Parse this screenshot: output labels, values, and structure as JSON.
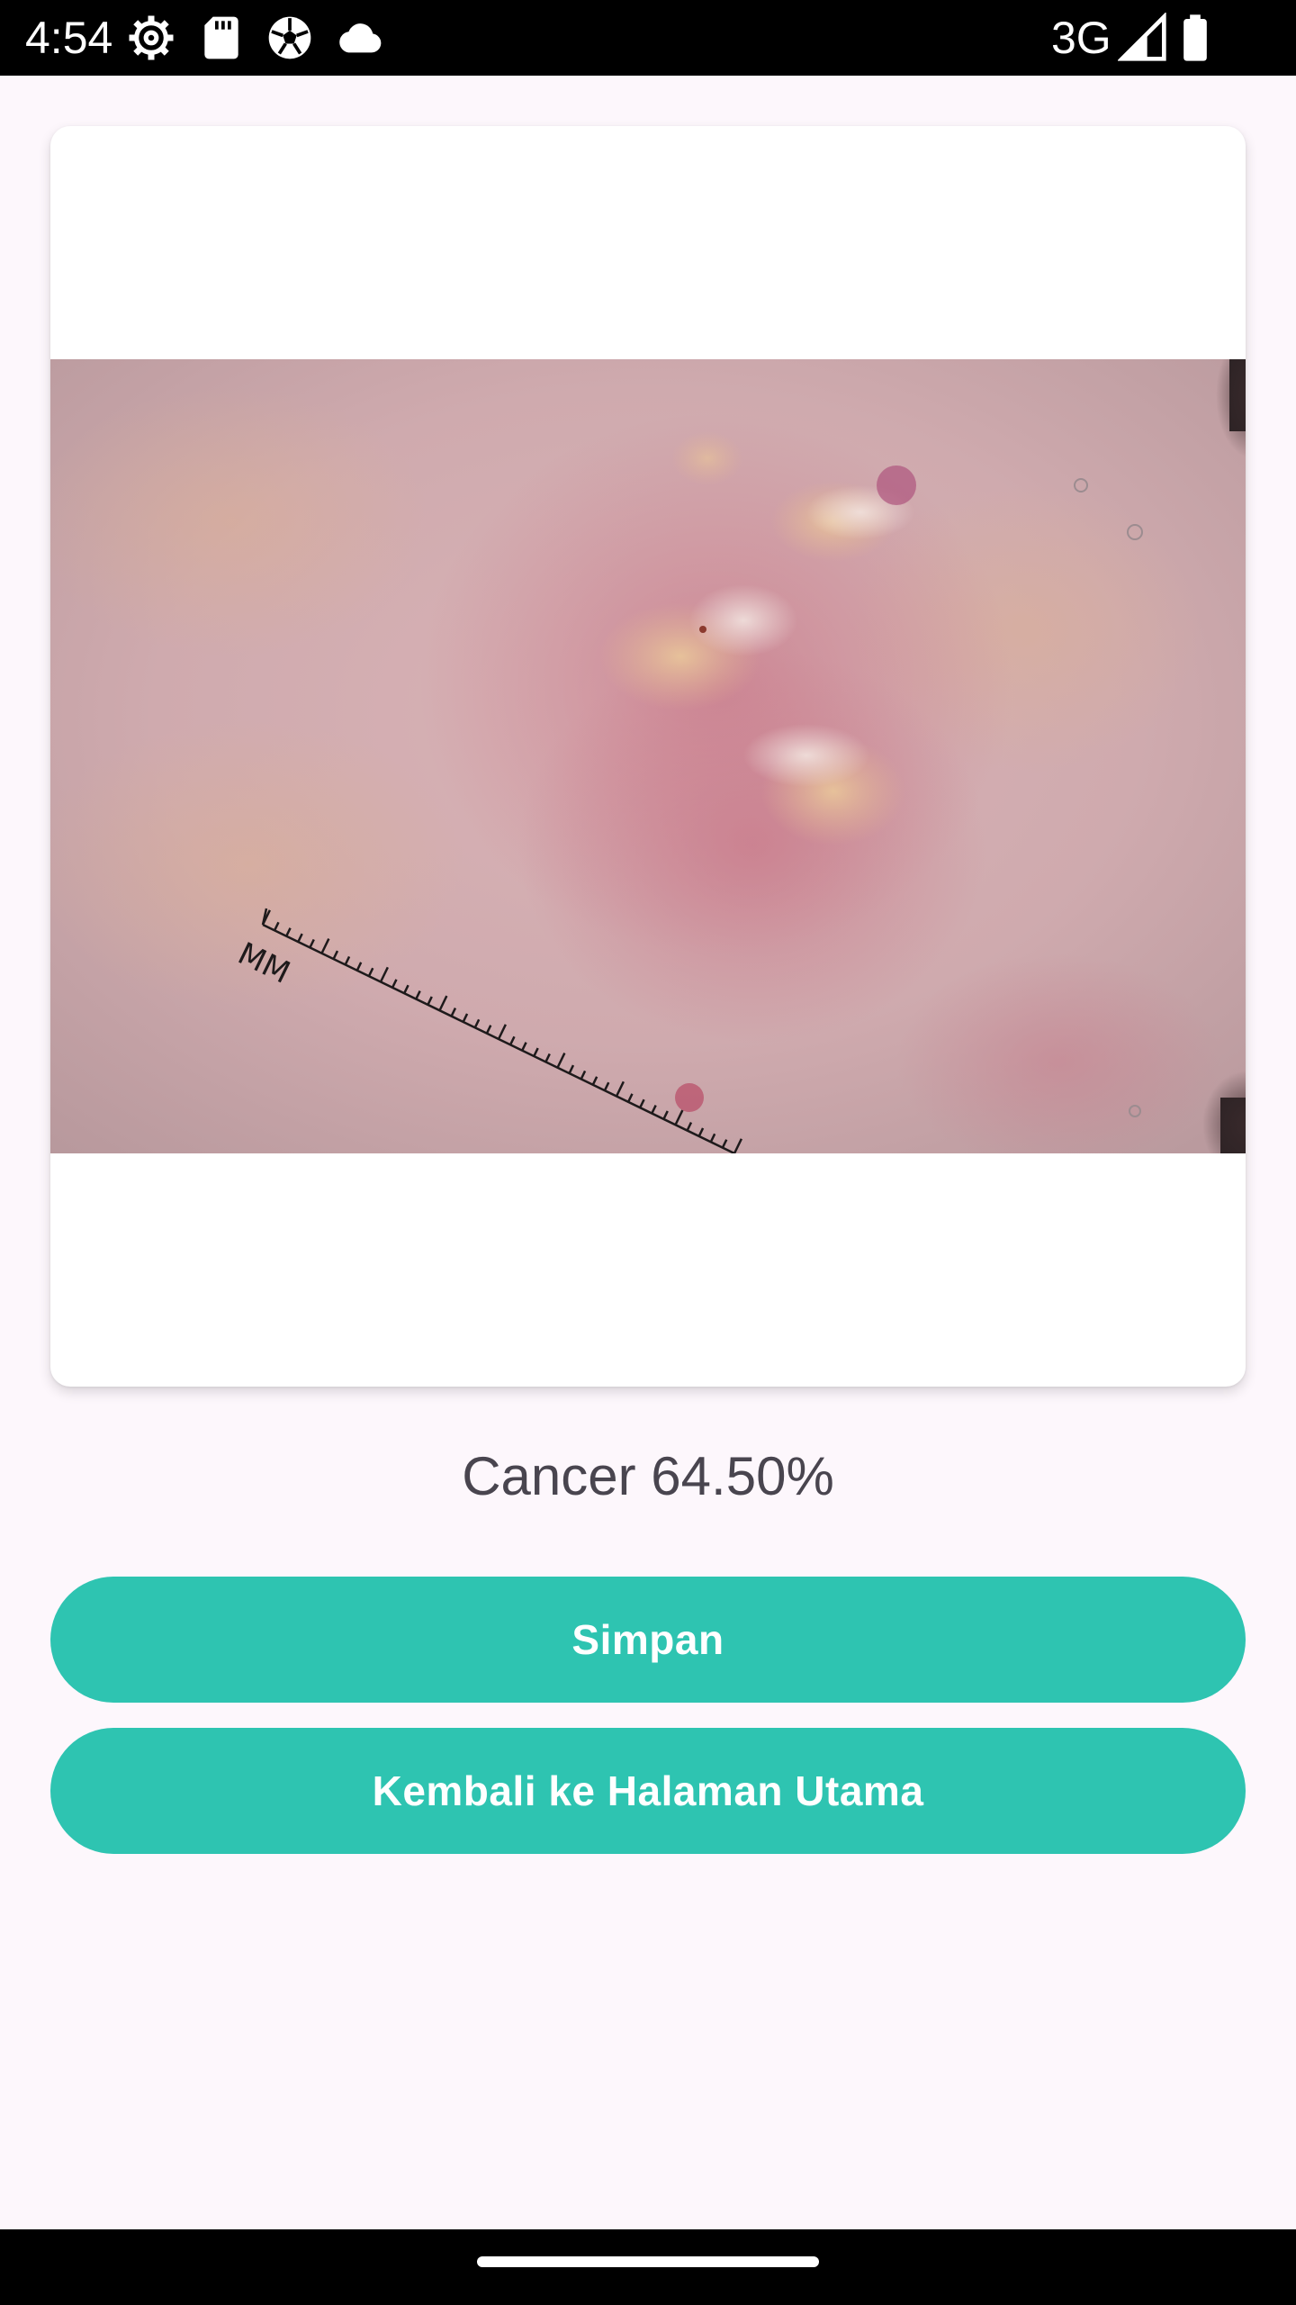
{
  "status_bar": {
    "time": "4:54",
    "network": "3G",
    "left_icons": [
      "settings-gear-icon",
      "sd-card-icon",
      "soccer-ball-icon",
      "cloud-icon"
    ],
    "right_icons": [
      "signal-icon",
      "battery-icon"
    ]
  },
  "card": {
    "image": "skin-lesion-dermoscopy-image",
    "ruler_label": "MM"
  },
  "result": {
    "text": "Cancer 64.50%"
  },
  "buttons": {
    "save_label": "Simpan",
    "home_label": "Kembali ke Halaman Utama"
  },
  "colors": {
    "background": "#FDF7FC",
    "button": "#2EC4B1",
    "result_text": "#49454F"
  }
}
